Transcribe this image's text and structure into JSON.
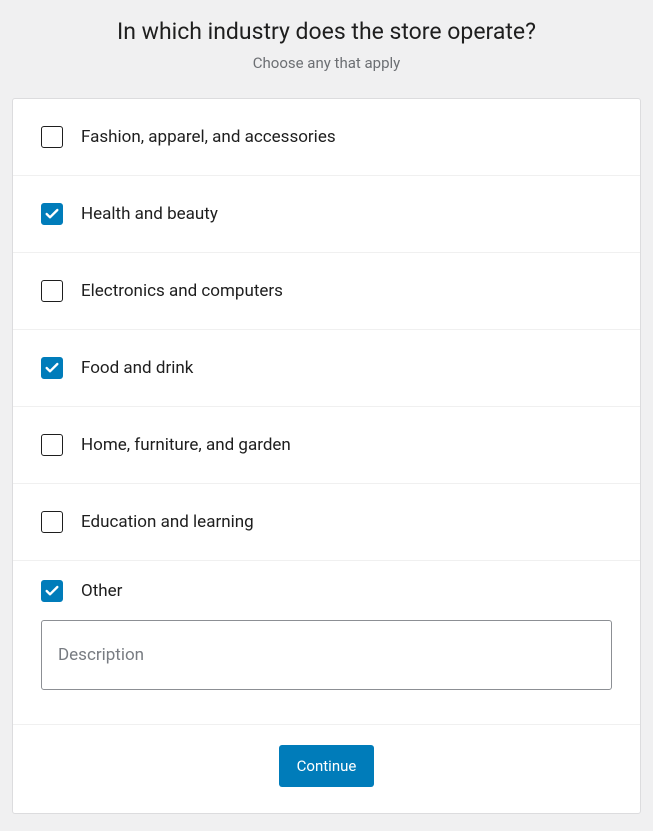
{
  "header": {
    "title": "In which industry does the store operate?",
    "subtitle": "Choose any that apply"
  },
  "options": [
    {
      "label": "Fashion, apparel, and accessories",
      "checked": false
    },
    {
      "label": "Health and beauty",
      "checked": true
    },
    {
      "label": "Electronics and computers",
      "checked": false
    },
    {
      "label": "Food and drink",
      "checked": true
    },
    {
      "label": "Home, furniture, and garden",
      "checked": false
    },
    {
      "label": "Education and learning",
      "checked": false
    }
  ],
  "other": {
    "label": "Other",
    "checked": true,
    "description_placeholder": "Description",
    "description_value": ""
  },
  "footer": {
    "continue_label": "Continue"
  }
}
